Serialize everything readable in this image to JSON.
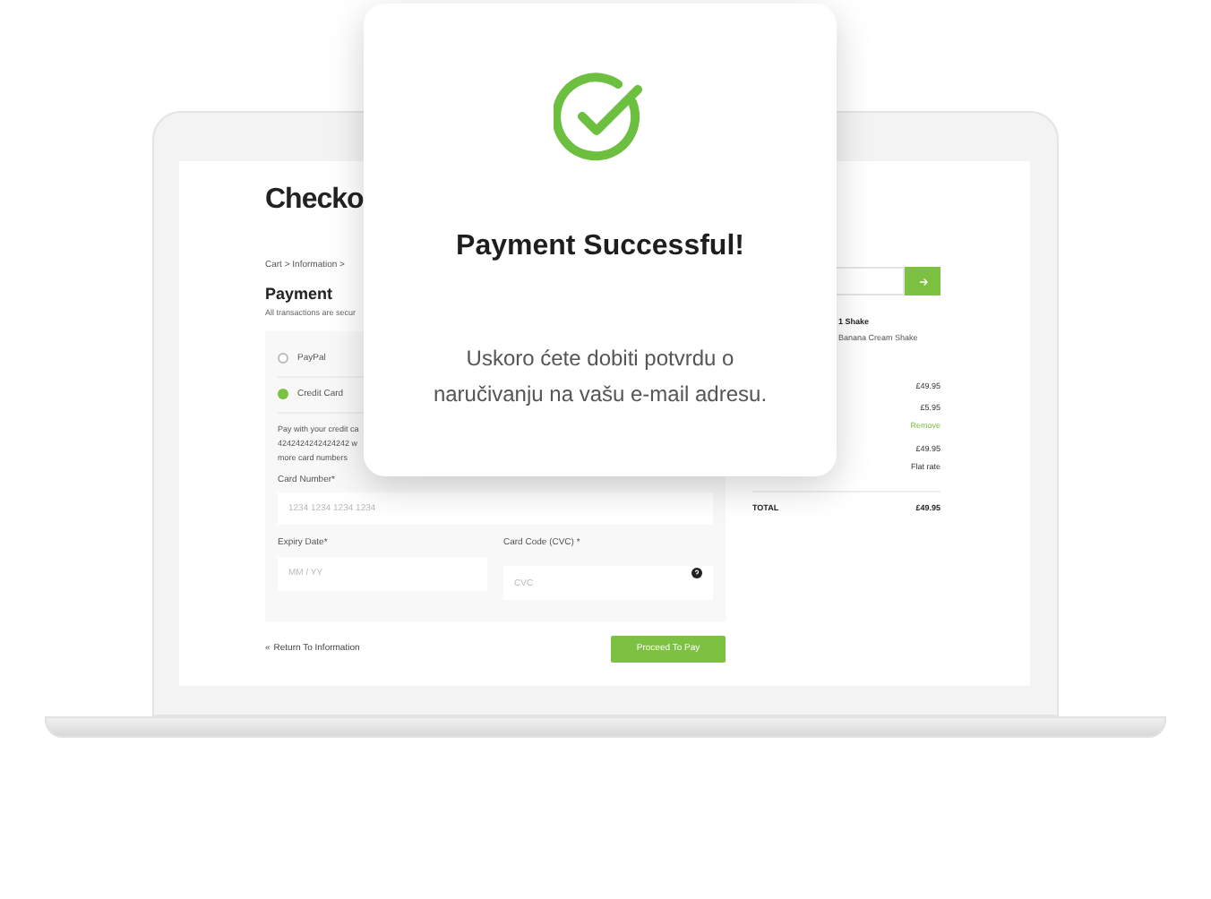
{
  "checkout": {
    "heading": "Checko",
    "breadcrumb": "Cart > Information >",
    "section_title": "Payment",
    "section_note": "All transactions are secur",
    "methods": [
      {
        "label": "PayPal",
        "selected": false
      },
      {
        "label": "Credit Card",
        "selected": true
      }
    ],
    "card_note": [
      "Pay with your credit ca",
      "4242424242424242 w",
      "more card numbers"
    ],
    "card_number": {
      "label": "Card Number*",
      "placeholder": "1234 1234 1234 1234"
    },
    "expiry": {
      "label": "Expiry Date*",
      "placeholder": "MM / YY"
    },
    "cvc": {
      "label": "Card Code (CVC) *",
      "placeholder": "CVC"
    },
    "back_icon": "«",
    "back_link": "Return To Information",
    "submit": "Proceed To Pay"
  },
  "summary": {
    "item_qty_name": "1 Shake",
    "item_detail": "Banana Cream Shake",
    "lines": [
      {
        "kind": "price",
        "value": "£49.95"
      },
      {
        "kind": "price",
        "value": "£5.95"
      },
      {
        "kind": "link",
        "value": "Remove"
      },
      {
        "kind": "price",
        "value": "£49.95"
      },
      {
        "kind": "note",
        "value": "Flat rate"
      }
    ],
    "total_label": "TOTAL",
    "total_value": "£49.95"
  },
  "modal": {
    "title": "Payment Successful!",
    "message": "Uskoro ćete dobiti potvrdu o naručivanju na vašu e-mail adresu."
  }
}
